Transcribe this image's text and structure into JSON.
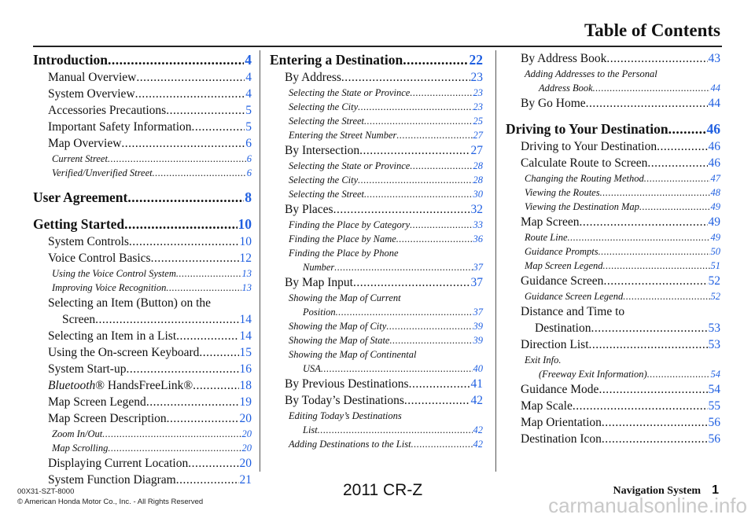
{
  "header": {
    "title": "Table of Contents"
  },
  "colors": {
    "page_link": "#1f5fe0"
  },
  "columns": [
    [
      {
        "level": 1,
        "title": "Introduction",
        "page": "4"
      },
      {
        "level": 2,
        "title": "Manual Overview",
        "page": "4"
      },
      {
        "level": 2,
        "title": "System Overview",
        "page": "4"
      },
      {
        "level": 2,
        "title": "Accessories Precautions",
        "page": "5"
      },
      {
        "level": 2,
        "title": "Important Safety Information",
        "page": "5"
      },
      {
        "level": 2,
        "title": "Map Overview",
        "page": "6"
      },
      {
        "level": 3,
        "title": "Current Street",
        "page": "6"
      },
      {
        "level": 3,
        "title": "Verified/Unverified Street",
        "page": "6"
      },
      {
        "level": 1,
        "title": "User Agreement",
        "page": "8",
        "gap": true
      },
      {
        "level": 1,
        "title": "Getting Started",
        "page": "10",
        "gap": true
      },
      {
        "level": 2,
        "title": "System Controls",
        "page": "10"
      },
      {
        "level": 2,
        "title": "Voice Control Basics",
        "page": "12"
      },
      {
        "level": 3,
        "title": "Using the Voice Control System",
        "page": "13"
      },
      {
        "level": 3,
        "title": "Improving Voice Recognition",
        "page": "13"
      },
      {
        "level": 2,
        "title": "Selecting an Item (Button) on the",
        "cont": "Screen",
        "page": "14"
      },
      {
        "level": 2,
        "title": "Selecting an Item in a List",
        "page": "14"
      },
      {
        "level": 2,
        "title": "Using the On-screen Keyboard",
        "page": "15"
      },
      {
        "level": 2,
        "title": "System Start-up",
        "page": "16"
      },
      {
        "level": 2,
        "em": "Bluetooth",
        "title": "® HandsFreeLink®",
        "page": "18"
      },
      {
        "level": 2,
        "title": "Map Screen Legend",
        "page": "19"
      },
      {
        "level": 2,
        "title": "Map Screen Description",
        "page": "20"
      },
      {
        "level": 3,
        "title": "Zoom In/Out",
        "page": "20"
      },
      {
        "level": 3,
        "title": "Map Scrolling",
        "page": "20"
      },
      {
        "level": 2,
        "title": "Displaying Current Location",
        "page": "20"
      },
      {
        "level": 2,
        "title": "System Function Diagram",
        "page": "21"
      }
    ],
    [
      {
        "level": 1,
        "title": "Entering a Destination",
        "page": "22"
      },
      {
        "level": 2,
        "title": "By Address",
        "page": "23"
      },
      {
        "level": 3,
        "title": "Selecting the State or Province",
        "page": "23"
      },
      {
        "level": 3,
        "title": "Selecting the City",
        "page": "23"
      },
      {
        "level": 3,
        "title": "Selecting the Street",
        "page": "25"
      },
      {
        "level": 3,
        "title": "Entering the Street Number",
        "page": "27"
      },
      {
        "level": 2,
        "title": "By Intersection",
        "page": "27"
      },
      {
        "level": 3,
        "title": "Selecting the State or Province",
        "page": "28"
      },
      {
        "level": 3,
        "title": "Selecting the City",
        "page": "28"
      },
      {
        "level": 3,
        "title": "Selecting the Street",
        "page": "30"
      },
      {
        "level": 2,
        "title": "By Places",
        "page": "32"
      },
      {
        "level": 3,
        "title": "Finding the Place by Category",
        "page": "33"
      },
      {
        "level": 3,
        "title": "Finding the Place by Name",
        "page": "36"
      },
      {
        "level": 3,
        "title": "Finding the Place by Phone",
        "cont": "Number",
        "page": "37"
      },
      {
        "level": 2,
        "title": "By Map Input",
        "page": "37"
      },
      {
        "level": 3,
        "title": "Showing the Map of Current",
        "cont": "Position",
        "page": "37"
      },
      {
        "level": 3,
        "title": "Showing the Map of City",
        "page": "39"
      },
      {
        "level": 3,
        "title": "Showing the Map of State",
        "page": "39"
      },
      {
        "level": 3,
        "title": "Showing the Map of Continental",
        "cont": "USA",
        "page": "40"
      },
      {
        "level": 2,
        "title": "By Previous Destinations",
        "page": "41"
      },
      {
        "level": 2,
        "title": "By Today’s Destinations",
        "page": "42"
      },
      {
        "level": 3,
        "title": "Editing Today’s Destinations",
        "cont": "List",
        "page": "42"
      },
      {
        "level": 3,
        "title": "Adding Destinations to the List",
        "page": "42"
      }
    ],
    [
      {
        "level": 2,
        "title": "By Address Book",
        "page": "43"
      },
      {
        "level": 3,
        "title": "Adding Addresses to the Personal",
        "cont": "Address Book",
        "page": "44"
      },
      {
        "level": 2,
        "title": "By Go Home",
        "page": "44"
      },
      {
        "level": 1,
        "title": "Driving to Your Destination",
        "page": "46",
        "gap": true
      },
      {
        "level": 2,
        "title": "Driving to Your Destination",
        "page": "46"
      },
      {
        "level": 2,
        "title": "Calculate Route to Screen",
        "page": "46"
      },
      {
        "level": 3,
        "title": "Changing the Routing Method",
        "page": "47"
      },
      {
        "level": 3,
        "title": "Viewing the Routes",
        "page": "48"
      },
      {
        "level": 3,
        "title": "Viewing the Destination Map",
        "page": "49"
      },
      {
        "level": 2,
        "title": "Map Screen",
        "page": "49"
      },
      {
        "level": 3,
        "title": "Route Line",
        "page": "49"
      },
      {
        "level": 3,
        "title": "Guidance Prompts",
        "page": "50"
      },
      {
        "level": 3,
        "title": "Map Screen Legend",
        "page": "51"
      },
      {
        "level": 2,
        "title": "Guidance Screen",
        "page": "52"
      },
      {
        "level": 3,
        "title": "Guidance Screen Legend",
        "page": "52"
      },
      {
        "level": 2,
        "title": "Distance and Time to",
        "cont": "Destination",
        "page": "53"
      },
      {
        "level": 2,
        "title": "Direction List",
        "page": "53"
      },
      {
        "level": 3,
        "title": "Exit Info.",
        "cont": "(Freeway Exit Information)",
        "page": "54"
      },
      {
        "level": 2,
        "title": "Guidance Mode",
        "page": "54"
      },
      {
        "level": 2,
        "title": "Map Scale",
        "page": "55"
      },
      {
        "level": 2,
        "title": "Map Orientation",
        "page": "56"
      },
      {
        "level": 2,
        "title": "Destination Icon",
        "page": "56"
      }
    ]
  ],
  "footer": {
    "code": "00X31-SZT-8000",
    "copyright": "© American Honda Motor Co., Inc. - All Rights Reserved",
    "model": "2011 CR-Z",
    "section": "Navigation System",
    "page_number": "1",
    "watermark": "carmanualsonline.info"
  }
}
